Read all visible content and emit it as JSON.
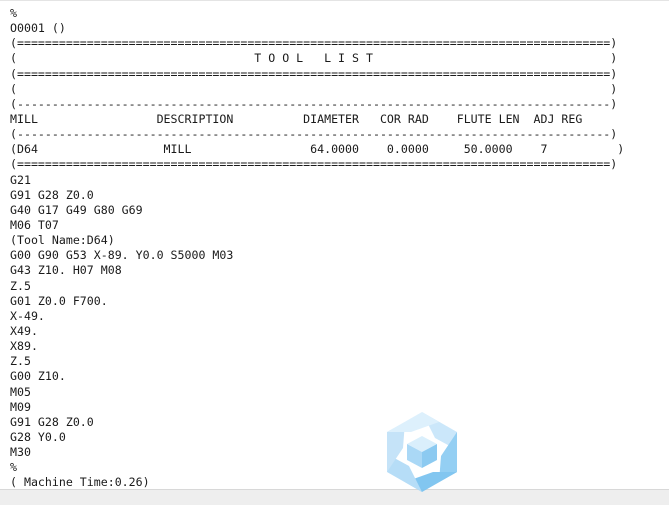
{
  "document": {
    "type": "G-code program listing",
    "lines": [
      "%",
      "O0001 ()",
      "(=====================================================================================)",
      "(                                  T O O L   L I S T                                  )",
      "(=====================================================================================)",
      "(                                                                                     )",
      "(-------------------------------------------------------------------------------------)",
      "MILL                 DESCRIPTION          DIAMETER   COR RAD    FLUTE LEN  ADJ REG",
      "(-------------------------------------------------------------------------------------)",
      "(D64                  MILL                 64.0000    0.0000     50.0000    7          )",
      "(=====================================================================================)",
      "G21",
      "G91 G28 Z0.0",
      "G40 G17 G49 G80 G69",
      "M06 T07",
      "(Tool Name:D64)",
      "G00 G90 G53 X-89. Y0.0 S5000 M03",
      "G43 Z10. H07 M08",
      "Z.5",
      "G01 Z0.0 F700.",
      "X-49.",
      "X49.",
      "X89.",
      "Z.5",
      "G00 Z10.",
      "M05",
      "M09",
      "G91 G28 Z0.0",
      "G28 Y0.0",
      "M30",
      "%",
      "( Machine Time:0.26)"
    ]
  },
  "tool_list": {
    "title": "T O O L   L I S T",
    "columns": [
      "MILL",
      "DESCRIPTION",
      "DIAMETER",
      "COR RAD",
      "FLUTE LEN",
      "ADJ REG"
    ],
    "rows": [
      {
        "mill": "D64",
        "description": "MILL",
        "diameter": "64.0000",
        "cor_rad": "0.0000",
        "flute_len": "50.0000",
        "adj_reg": "7"
      }
    ]
  },
  "machine_time": "0.26",
  "watermark": {
    "icon": "hexagon-cube-logo-icon",
    "colors": {
      "light": "#d6ecfb",
      "mid": "#a9d8f7",
      "dark": "#7cc3f0"
    }
  }
}
